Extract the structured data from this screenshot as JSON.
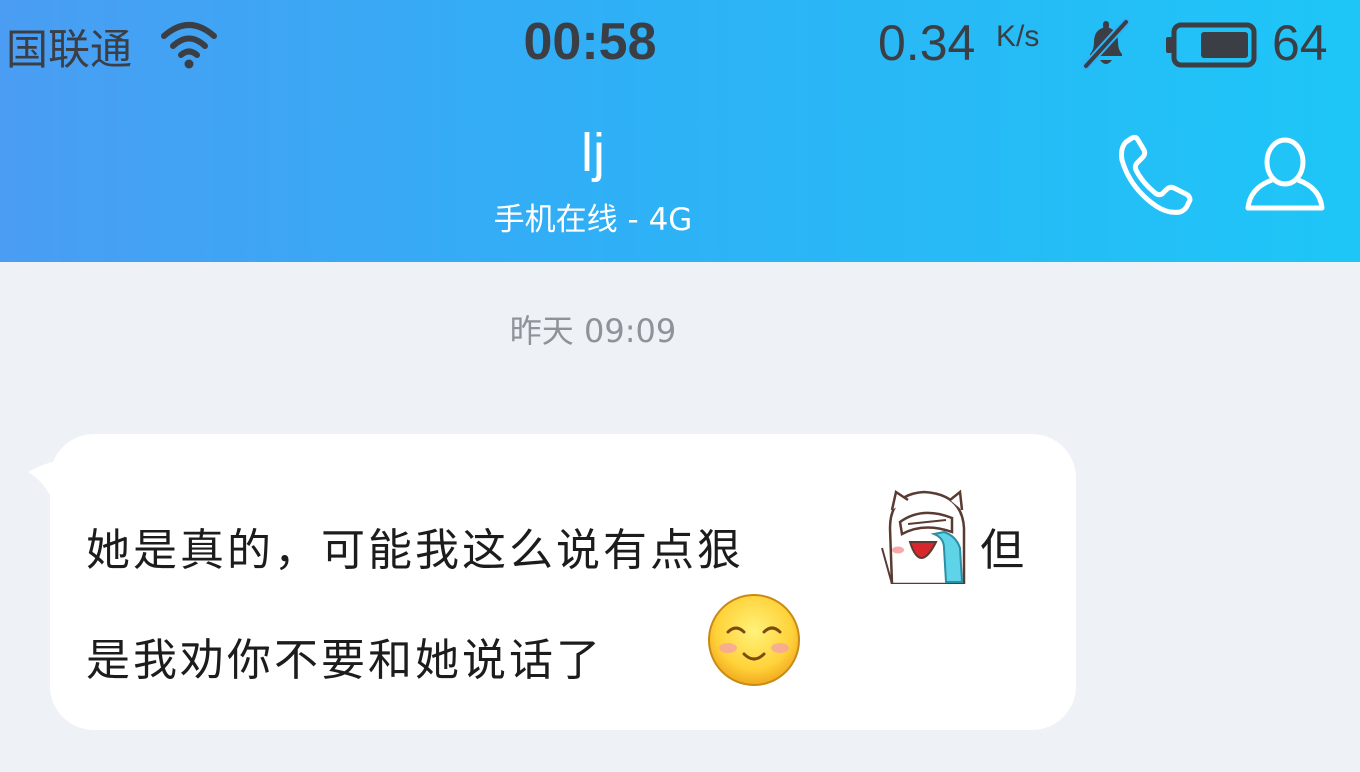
{
  "status_bar": {
    "carrier": "国联通",
    "time": "00:58",
    "net_speed": "0.34",
    "net_speed_unit": "K/s",
    "battery": "64",
    "battery_fraction": 0.64,
    "icons": [
      "wifi-icon",
      "bell-off-icon",
      "battery-icon"
    ]
  },
  "header": {
    "contact_name": "lj",
    "contact_status": "手机在线 - 4G",
    "icons": [
      "phone-icon",
      "profile-icon"
    ]
  },
  "chat": {
    "timestamp": "昨天 09:09",
    "message": {
      "line1": "她是真的，可能我这么说有点狠",
      "line1_tail": "但",
      "line2": "是我劝你不要和她说话了",
      "stickers": [
        "facepalm-crying-sticker",
        "blush-smile-emoji"
      ]
    }
  },
  "colors": {
    "header_gradient_start": "#4a9df3",
    "header_gradient_end": "#1ec6f7",
    "chat_background": "#eef1f6",
    "bubble": "#ffffff",
    "status_text": "#3b3f45"
  }
}
